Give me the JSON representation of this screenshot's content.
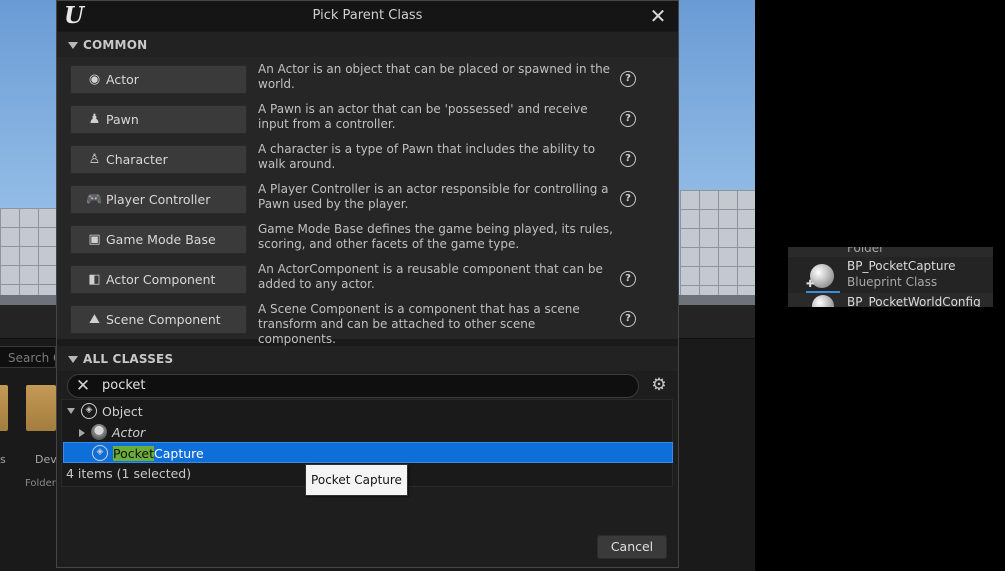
{
  "background": {
    "search_placeholder": "Search C",
    "folders": [
      {
        "label": "s"
      },
      {
        "label": "Dev"
      }
    ],
    "folder_type": "Folder",
    "asset_panel": {
      "row_above_fragment": "Folder",
      "asset_name": "BP_PocketCapture",
      "asset_type": "Blueprint Class",
      "next_asset_name": "BP_PocketWorldConfig"
    }
  },
  "dialog": {
    "title": "Pick Parent Class",
    "common_header": "COMMON",
    "common_classes": [
      {
        "label": "Actor",
        "icon": "actor-icon",
        "glyph": "◉",
        "description": "An Actor is an object that can be placed or spawned in the world.",
        "has_help": true
      },
      {
        "label": "Pawn",
        "icon": "pawn-icon",
        "glyph": "♟",
        "description": "A Pawn is an actor that can be 'possessed' and receive input from a controller.",
        "has_help": true
      },
      {
        "label": "Character",
        "icon": "character-icon",
        "glyph": "♙",
        "description": "A character is a type of Pawn that includes the ability to walk around.",
        "has_help": true
      },
      {
        "label": "Player Controller",
        "icon": "gamepad-icon",
        "glyph": "🎮",
        "description": "A Player Controller is an actor responsible for controlling a Pawn used by the player.",
        "has_help": true
      },
      {
        "label": "Game Mode Base",
        "icon": "game-mode-icon",
        "glyph": "▣",
        "description": "Game Mode Base defines the game being played, its rules, scoring, and other facets of the game type.",
        "has_help": false
      },
      {
        "label": "Actor Component",
        "icon": "actor-component-icon",
        "glyph": "◧",
        "description": "An ActorComponent is a reusable component that can be added to any actor.",
        "has_help": true
      },
      {
        "label": "Scene Component",
        "icon": "scene-component-icon",
        "glyph": "⛰",
        "description": "A Scene Component is a component that has a scene transform and can be attached to other scene components.",
        "has_help": true
      }
    ],
    "help_glyph": "?",
    "all_classes_header": "ALL CLASSES",
    "search": {
      "value": "pocket"
    },
    "tree": [
      {
        "label": "Object",
        "expanded": true
      },
      {
        "label": "Actor",
        "expanded": false
      },
      {
        "label_highlight": "Pocket",
        "label_rest": "Capture",
        "selected": true
      }
    ],
    "items_count": "4 items (1 selected)",
    "tooltip": "Pocket Capture",
    "cancel_label": "Cancel"
  }
}
